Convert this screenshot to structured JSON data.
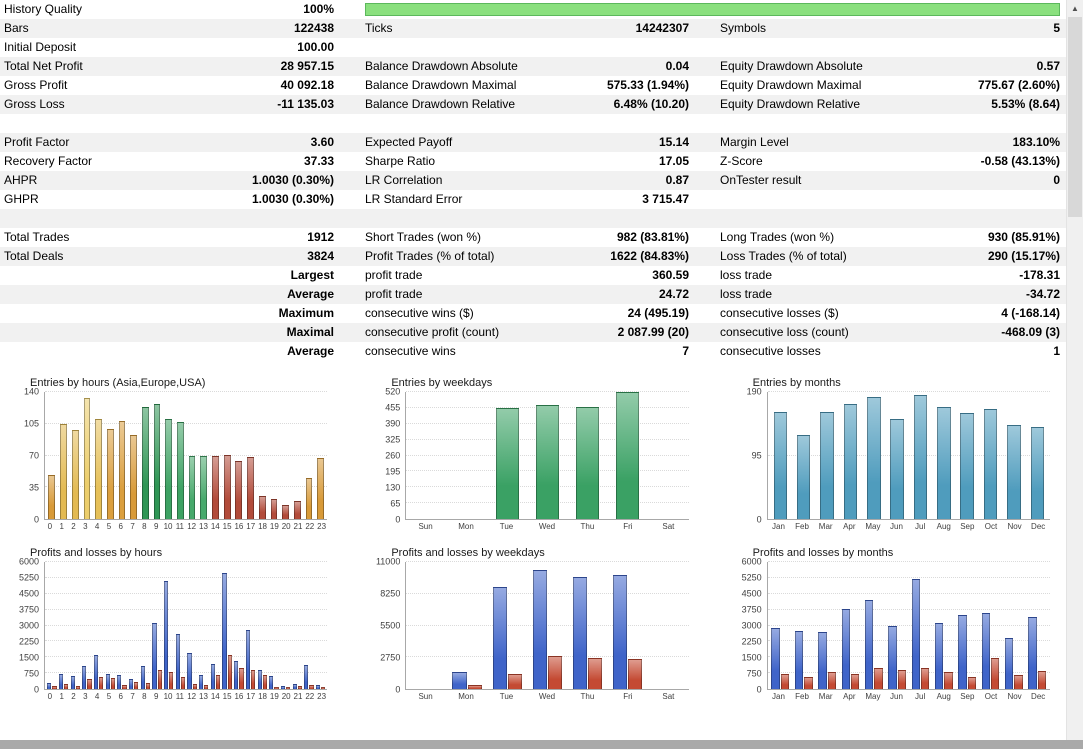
{
  "scrollbar": {
    "up_icon": "▲"
  },
  "stats_table": {
    "row_alt_color": "#f1f1f1",
    "progress": {
      "value_pct": 100,
      "fill_color": "#8ae07e",
      "border_color": "#5cb85c"
    },
    "rows": [
      {
        "cells": [
          "History Quality",
          "100%"
        ],
        "progress": true
      },
      {
        "cells": [
          "Bars",
          "122438",
          "Ticks",
          "14242307",
          "Symbols",
          "5"
        ]
      },
      {
        "cells": [
          "Initial Deposit",
          "100.00",
          "",
          "",
          "",
          ""
        ]
      },
      {
        "cells": [
          "Total Net Profit",
          "28 957.15",
          "Balance Drawdown Absolute",
          "0.04",
          "Equity Drawdown Absolute",
          "0.57"
        ]
      },
      {
        "cells": [
          "Gross Profit",
          "40 092.18",
          "Balance Drawdown Maximal",
          "575.33 (1.94%)",
          "Equity Drawdown Maximal",
          "775.67 (2.60%)"
        ]
      },
      {
        "cells": [
          "Gross Loss",
          "-11 135.03",
          "Balance Drawdown Relative",
          "6.48% (10.20)",
          "Equity Drawdown Relative",
          "5.53% (8.64)"
        ]
      },
      {
        "cells": [
          "",
          "",
          "",
          "",
          "",
          ""
        ]
      },
      {
        "cells": [
          "Profit Factor",
          "3.60",
          "Expected Payoff",
          "15.14",
          "Margin Level",
          "183.10%"
        ]
      },
      {
        "cells": [
          "Recovery Factor",
          "37.33",
          "Sharpe Ratio",
          "17.05",
          "Z-Score",
          "-0.58 (43.13%)"
        ]
      },
      {
        "cells": [
          "AHPR",
          "1.0030 (0.30%)",
          "LR Correlation",
          "0.87",
          "OnTester result",
          "0"
        ]
      },
      {
        "cells": [
          "GHPR",
          "1.0030 (0.30%)",
          "LR Standard Error",
          "3 715.47",
          "",
          ""
        ]
      },
      {
        "cells": [
          "",
          "",
          "",
          "",
          "",
          ""
        ]
      },
      {
        "cells": [
          "Total Trades",
          "1912",
          "Short Trades (won %)",
          "982 (83.81%)",
          "Long Trades (won %)",
          "930 (85.91%)"
        ]
      },
      {
        "cells": [
          "Total Deals",
          "3824",
          "Profit Trades (% of total)",
          "1622 (84.83%)",
          "Loss Trades (% of total)",
          "290 (15.17%)"
        ]
      },
      {
        "cells": [
          "",
          "Largest",
          "profit trade",
          "360.59",
          "loss trade",
          "-178.31"
        ]
      },
      {
        "cells": [
          "",
          "Average",
          "profit trade",
          "24.72",
          "loss trade",
          "-34.72"
        ]
      },
      {
        "cells": [
          "",
          "Maximum",
          "consecutive wins ($)",
          "24 (495.19)",
          "consecutive losses ($)",
          "4 (-168.14)"
        ]
      },
      {
        "cells": [
          "",
          "Maximal",
          "consecutive profit (count)",
          "2 087.99 (20)",
          "consecutive loss (count)",
          "-468.09 (3)"
        ]
      },
      {
        "cells": [
          "",
          "Average",
          "consecutive wins",
          "7",
          "consecutive losses",
          "1"
        ]
      }
    ]
  },
  "chart_data": [
    {
      "type": "bar",
      "title": "Entries by hours (Asia,Europe,USA)",
      "ylim": [
        0,
        140
      ],
      "yticks": [
        0,
        35,
        70,
        105,
        140
      ],
      "categories": [
        "0",
        "1",
        "2",
        "3",
        "4",
        "5",
        "6",
        "7",
        "8",
        "9",
        "10",
        "11",
        "12",
        "13",
        "14",
        "15",
        "16",
        "17",
        "18",
        "19",
        "20",
        "21",
        "22",
        "23"
      ],
      "series": [
        {
          "name": "entries",
          "values": [
            48,
            105,
            98,
            133,
            110,
            99,
            108,
            93,
            124,
            127,
            110,
            107,
            70,
            70,
            70,
            71,
            64,
            68,
            25,
            22,
            15,
            20,
            45,
            67
          ],
          "colors": [
            "#d89a38",
            "#e3ba52",
            "#e3ba52",
            "#ecce6c",
            "#e6c058",
            "#db9f3e",
            "#db9f3e",
            "#d89a38",
            "#2f9655",
            "#2f9655",
            "#3da263",
            "#3da263",
            "#47a96c",
            "#47a96c",
            "#b24b3a",
            "#b24b3a",
            "#b24b3a",
            "#b24b3a",
            "#b24b3a",
            "#b24b3a",
            "#b24b3a",
            "#b24b3a",
            "#d89a38",
            "#d89a38"
          ]
        }
      ]
    },
    {
      "type": "bar",
      "title": "Entries by weekdays",
      "ylim": [
        0,
        520
      ],
      "yticks": [
        0,
        65,
        130,
        195,
        260,
        325,
        390,
        455,
        520
      ],
      "categories": [
        "Sun",
        "Mon",
        "Tue",
        "Wed",
        "Thu",
        "Fri",
        "Sat"
      ],
      "series": [
        {
          "name": "entries",
          "color": "#3aa164",
          "values": [
            0,
            0,
            455,
            468,
            458,
            520,
            0
          ]
        }
      ]
    },
    {
      "type": "bar",
      "title": "Entries by months",
      "ylim": [
        0,
        190
      ],
      "yticks": [
        0,
        95,
        190
      ],
      "categories": [
        "Jan",
        "Feb",
        "Mar",
        "Apr",
        "May",
        "Jun",
        "Jul",
        "Aug",
        "Sep",
        "Oct",
        "Nov",
        "Dec"
      ],
      "series": [
        {
          "name": "entries",
          "color": "#4f9cbd",
          "values": [
            160,
            125,
            160,
            172,
            182,
            150,
            186,
            168,
            158,
            165,
            140,
            138
          ]
        }
      ]
    },
    {
      "type": "bar",
      "title": "Profits and losses by hours",
      "ylim": [
        0,
        6000
      ],
      "yticks": [
        0,
        750,
        1500,
        2250,
        3000,
        3750,
        4500,
        5250,
        6000
      ],
      "categories": [
        "0",
        "1",
        "2",
        "3",
        "4",
        "5",
        "6",
        "7",
        "8",
        "9",
        "10",
        "11",
        "12",
        "13",
        "14",
        "15",
        "16",
        "17",
        "18",
        "19",
        "20",
        "21",
        "22",
        "23"
      ],
      "series": [
        {
          "name": "profit",
          "color": "#3f64c9",
          "values": [
            280,
            700,
            620,
            1100,
            1600,
            700,
            650,
            450,
            1100,
            3100,
            5100,
            2600,
            1700,
            650,
            1200,
            5500,
            1300,
            2800,
            900,
            600,
            150,
            250,
            1150,
            200
          ]
        },
        {
          "name": "loss",
          "color": "#c44a33",
          "values": [
            150,
            250,
            150,
            450,
            550,
            500,
            200,
            350,
            300,
            900,
            800,
            550,
            250,
            200,
            650,
            1600,
            1000,
            900,
            650,
            100,
            80,
            120,
            180,
            100
          ]
        }
      ]
    },
    {
      "type": "bar",
      "title": "Profits and losses by weekdays",
      "ylim": [
        0,
        11000
      ],
      "yticks": [
        0,
        2750,
        5500,
        8250,
        11000
      ],
      "categories": [
        "Sun",
        "Mon",
        "Tue",
        "Wed",
        "Thu",
        "Fri",
        "Sat"
      ],
      "series": [
        {
          "name": "profit",
          "color": "#3f64c9",
          "values": [
            0,
            1500,
            8800,
            10300,
            9700,
            9900,
            0
          ]
        },
        {
          "name": "loss",
          "color": "#c44a33",
          "values": [
            0,
            350,
            1300,
            2900,
            2700,
            2600,
            0
          ]
        }
      ]
    },
    {
      "type": "bar",
      "title": "Profits and losses by months",
      "ylim": [
        0,
        6000
      ],
      "yticks": [
        0,
        750,
        1500,
        2250,
        3000,
        3750,
        4500,
        5250,
        6000
      ],
      "categories": [
        "Jan",
        "Feb",
        "Mar",
        "Apr",
        "May",
        "Jun",
        "Jul",
        "Aug",
        "Sep",
        "Oct",
        "Nov",
        "Dec"
      ],
      "series": [
        {
          "name": "profit",
          "color": "#3f64c9",
          "values": [
            2900,
            2750,
            2700,
            3800,
            4200,
            3000,
            5200,
            3100,
            3500,
            3600,
            2400,
            3400
          ]
        },
        {
          "name": "loss",
          "color": "#c44a33",
          "values": [
            700,
            550,
            800,
            700,
            1000,
            900,
            1000,
            800,
            550,
            1450,
            650,
            850
          ]
        }
      ]
    }
  ]
}
